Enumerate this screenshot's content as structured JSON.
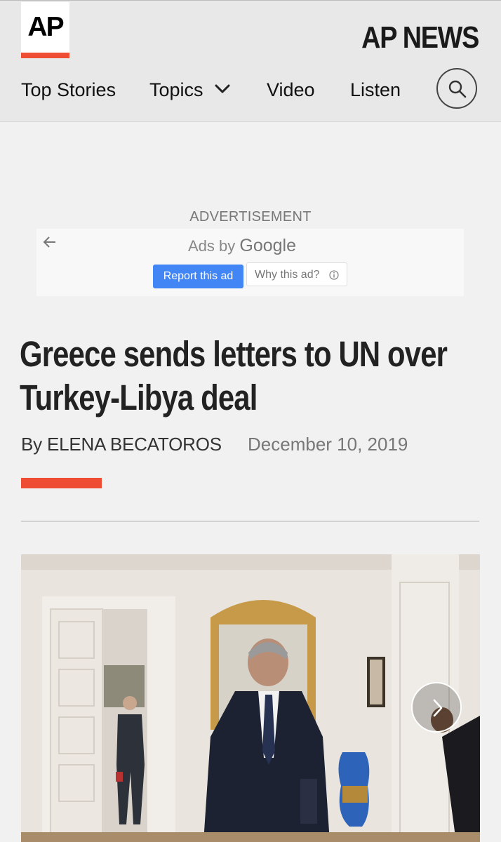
{
  "header": {
    "logo_text": "AP",
    "brand": "AP NEWS",
    "nav": {
      "top_stories": "Top Stories",
      "topics": "Topics",
      "video": "Video",
      "listen": "Listen"
    },
    "accent_color": "#ef4d33"
  },
  "ad": {
    "label": "ADVERTISEMENT",
    "ads_by": "Ads by",
    "ads_provider": "Google",
    "report_label": "Report this ad",
    "why_label": "Why this ad?",
    "report_color": "#4285f4"
  },
  "article": {
    "headline": "Greece sends letters to UN over Turkey-Libya deal",
    "byline": "By ELENA BECATOROS",
    "date": "December 10, 2019"
  },
  "icons": {
    "chevron": "chevron-down-icon",
    "search": "search-icon",
    "back": "arrow-left-icon",
    "info": "info-icon",
    "next": "chevron-right-icon"
  }
}
